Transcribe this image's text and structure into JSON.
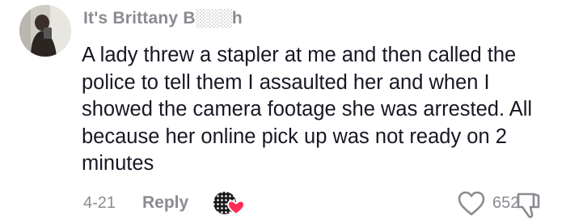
{
  "comment": {
    "username": "It's Brittany B░░░h",
    "text": "A lady threw a stapler at me and then called the police to tell them I assaulted her and when I showed the camera footage she was arrested. All because her online pick up was not ready on 2 minutes",
    "date": "4-21",
    "reply_label": "Reply",
    "like_count": "652",
    "avatar_icon": "user-avatar",
    "creator_like_icon": "creator-liked-heart-icon",
    "like_icon": "heart-outline-icon",
    "dislike_icon": "thumbs-down-icon",
    "colors": {
      "username": "#8a8b91",
      "text": "#161823",
      "meta": "#8a8b91",
      "heart_badge": "#fe2c55"
    }
  }
}
